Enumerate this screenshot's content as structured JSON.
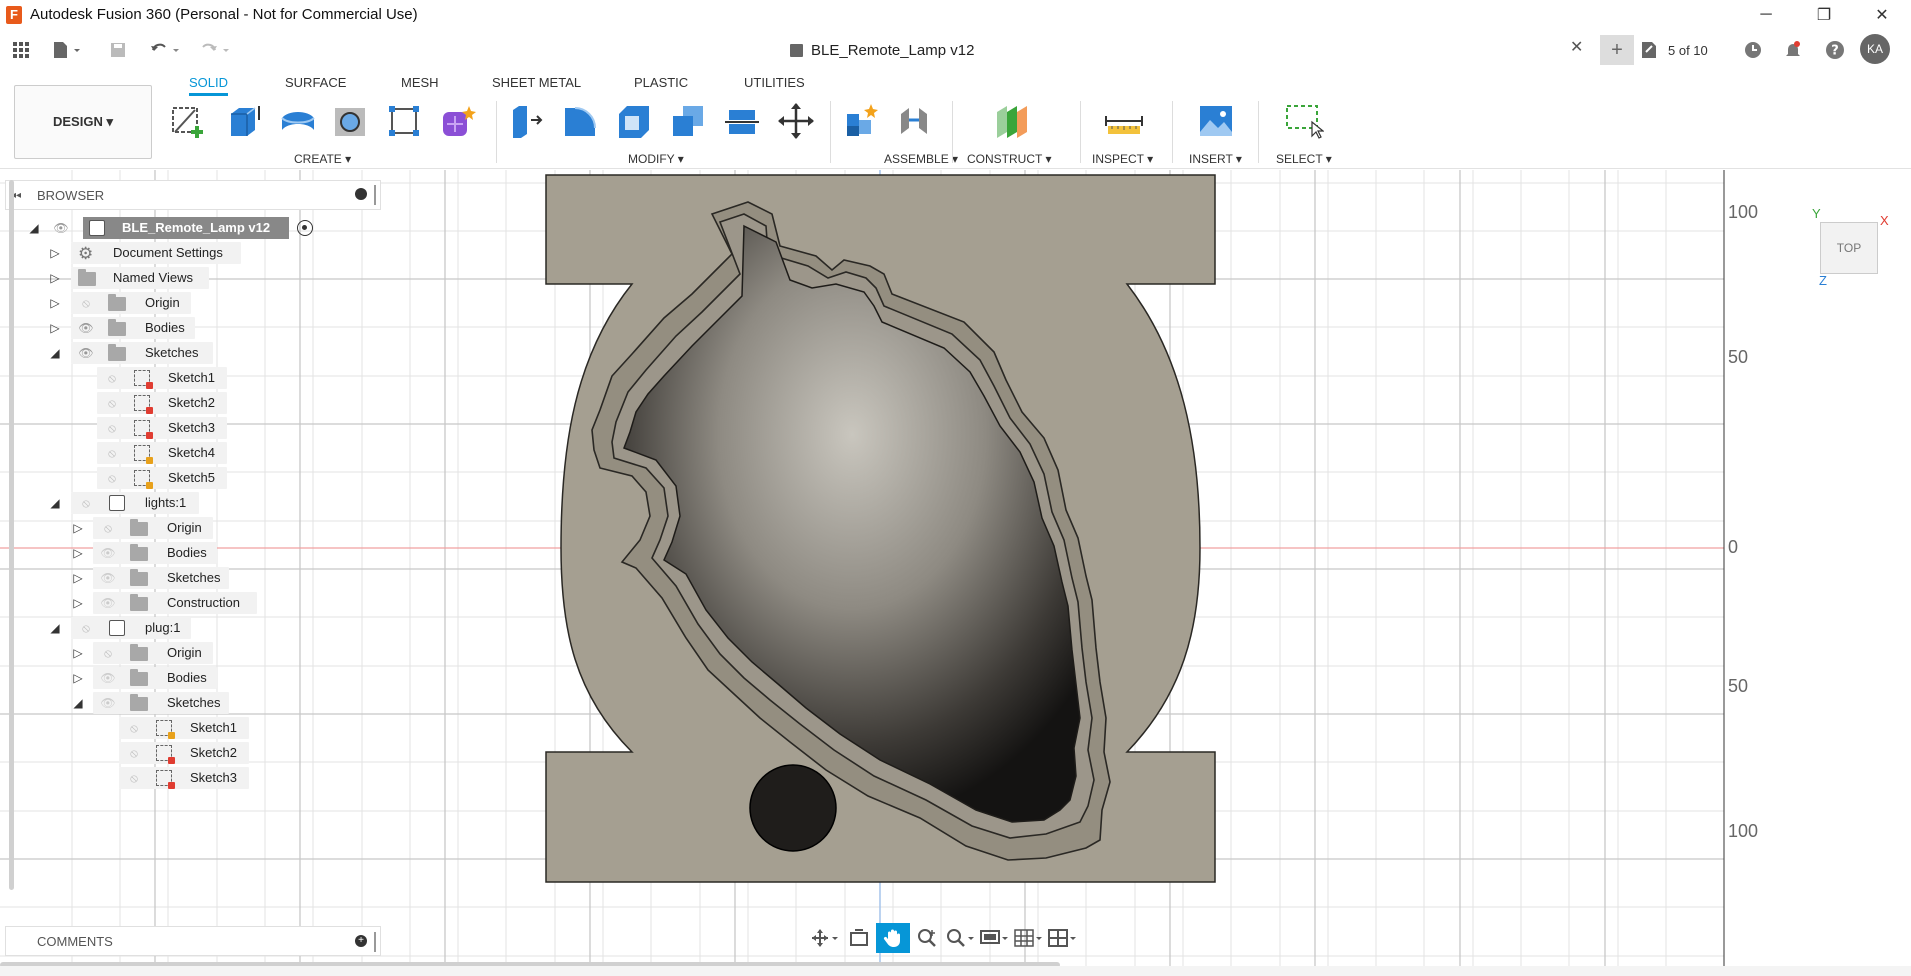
{
  "window": {
    "title": "Autodesk Fusion 360 (Personal - Not for Commercial Use)",
    "minimize_glyph": "─",
    "restore_glyph": "❐",
    "close_glyph": "✕"
  },
  "tabbar": {
    "doc_title": "BLE_Remote_Lamp v12",
    "close_glyph": "✕",
    "new_tab_glyph": "+",
    "version": "5 of 10",
    "avatar": "KA"
  },
  "ribbon": {
    "workspace": "DESIGN ▾",
    "tabs": [
      "SOLID",
      "SURFACE",
      "MESH",
      "SHEET METAL",
      "PLASTIC",
      "UTILITIES"
    ],
    "groups": [
      "CREATE ▾",
      "MODIFY ▾",
      "ASSEMBLE ▾",
      "CONSTRUCT ▾",
      "INSPECT ▾",
      "INSERT ▾",
      "SELECT ▾"
    ]
  },
  "browser": {
    "title": "BROWSER",
    "root": "BLE_Remote_Lamp v12",
    "items": [
      {
        "label": "Document Settings"
      },
      {
        "label": "Named Views"
      },
      {
        "label": "Origin"
      },
      {
        "label": "Bodies"
      },
      {
        "label": "Sketches"
      },
      {
        "label": "Sketch1"
      },
      {
        "label": "Sketch2"
      },
      {
        "label": "Sketch3"
      },
      {
        "label": "Sketch4"
      },
      {
        "label": "Sketch5"
      },
      {
        "label": "lights:1"
      },
      {
        "label": "Origin"
      },
      {
        "label": "Bodies"
      },
      {
        "label": "Sketches"
      },
      {
        "label": "Construction"
      },
      {
        "label": "plug:1"
      },
      {
        "label": "Origin"
      },
      {
        "label": "Bodies"
      },
      {
        "label": "Sketches"
      },
      {
        "label": "Sketch1"
      },
      {
        "label": "Sketch2"
      },
      {
        "label": "Sketch3"
      }
    ]
  },
  "comments": {
    "title": "COMMENTS"
  },
  "viewport": {
    "ruler_labels": [
      "100",
      "50",
      "0",
      "50",
      "100"
    ],
    "viewcube_face": "TOP",
    "axis_x": "X",
    "axis_y": "Y",
    "axis_z": "Z"
  },
  "colors": {
    "accent": "#0696d7",
    "part_fill": "#a59f91",
    "axis_red": "#f1a0a0",
    "axis_blue": "#a0c4f0"
  }
}
